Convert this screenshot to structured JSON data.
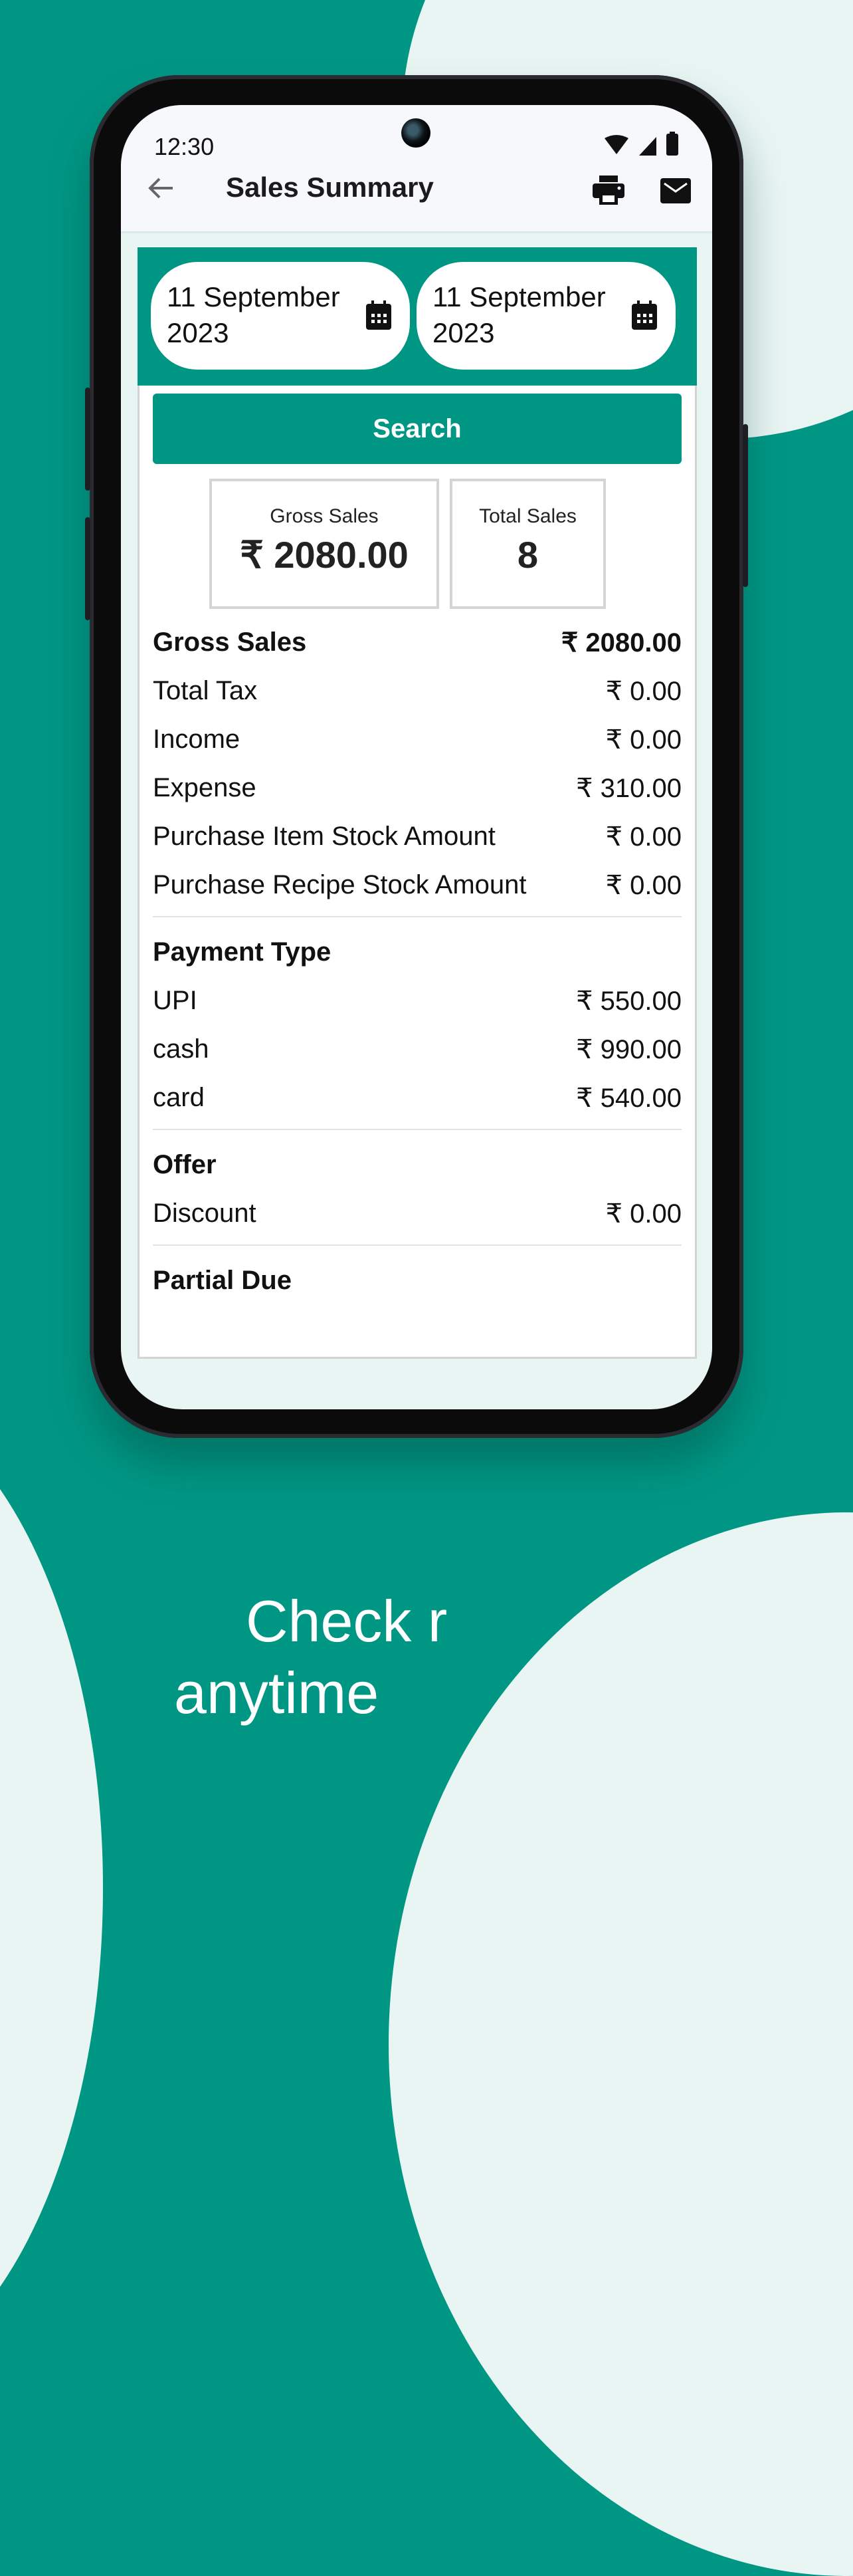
{
  "status_bar": {
    "time": "12:30",
    "icons": [
      "wifi-icon",
      "signal-icon",
      "battery-icon"
    ]
  },
  "app_bar": {
    "title": "Sales Summary",
    "back_icon": "arrow-left-icon",
    "actions": [
      "print-icon",
      "mail-icon"
    ]
  },
  "date_range": {
    "from": "11 September 2023",
    "to": "11 September 2023",
    "icon": "calendar-icon"
  },
  "search_label": "Search",
  "stats": [
    {
      "label": "Gross Sales",
      "value": "₹ 2080.00"
    },
    {
      "label": "Total Sales",
      "value": "8"
    }
  ],
  "summary": [
    {
      "label": "Gross Sales",
      "value": "₹ 2080.00",
      "bold": true
    },
    {
      "label": "Total Tax",
      "value": "₹ 0.00"
    },
    {
      "label": "Income",
      "value": "₹ 0.00"
    },
    {
      "label": "Expense",
      "value": "₹ 310.00"
    },
    {
      "label": "Purchase Item Stock Amount",
      "value": "₹ 0.00"
    },
    {
      "label": "Purchase Recipe Stock Amount",
      "value": "₹ 0.00"
    }
  ],
  "payment_type": {
    "title": "Payment Type",
    "items": [
      {
        "label": "UPI",
        "value": "₹ 550.00"
      },
      {
        "label": "cash",
        "value": "₹ 990.00"
      },
      {
        "label": "card",
        "value": "₹ 540.00"
      }
    ]
  },
  "offer": {
    "title": "Offer",
    "items": [
      {
        "label": "Discount",
        "value": "₹ 0.00"
      }
    ]
  },
  "partial_due": {
    "title": "Partial Due"
  },
  "promo": {
    "line1": "Check r",
    "line2": "anytime"
  },
  "colors": {
    "brand": "#009684",
    "background_light": "#e8f5f2"
  }
}
